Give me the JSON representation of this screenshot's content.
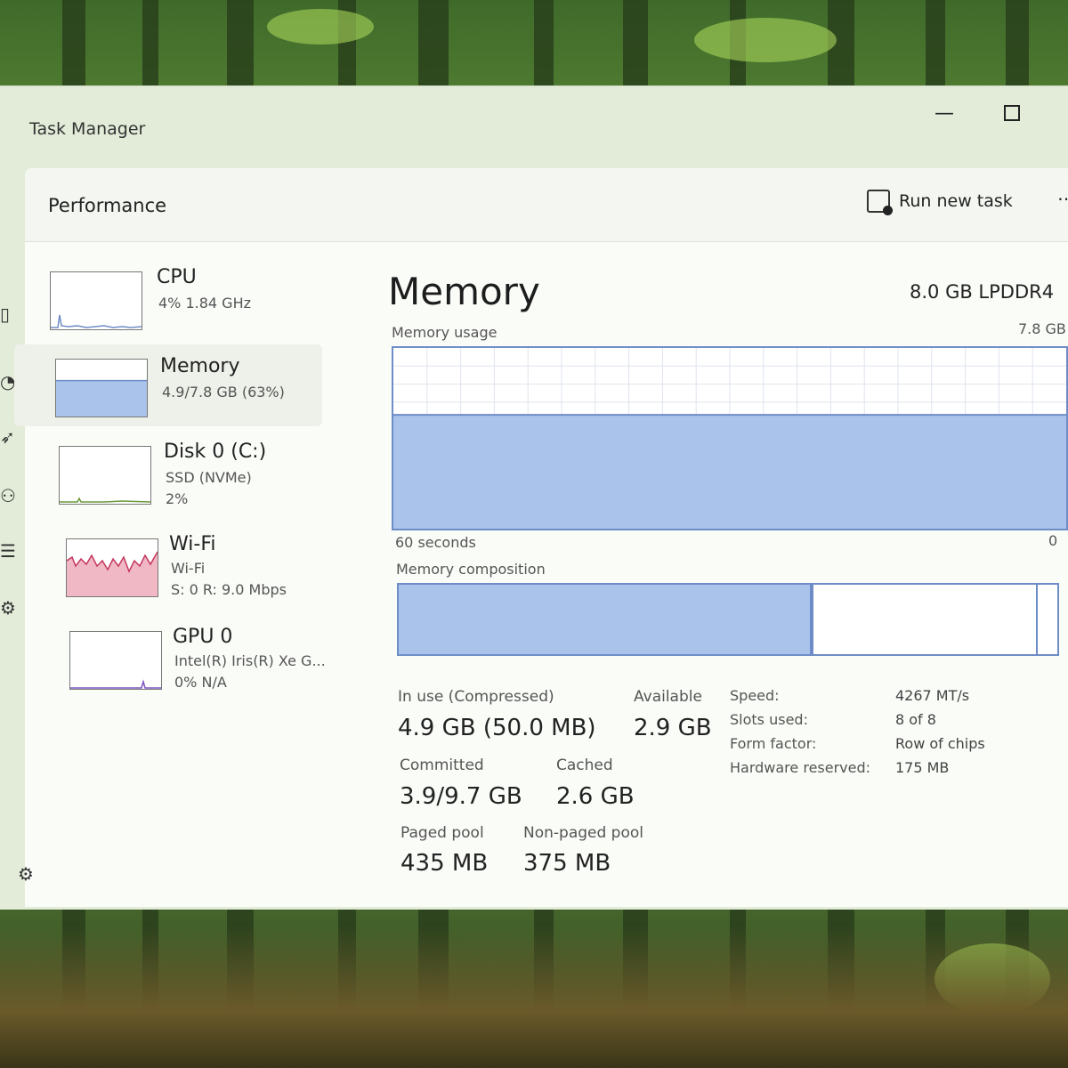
{
  "window": {
    "title": "Task Manager"
  },
  "header": {
    "title": "Performance",
    "run_new_task": "Run new task",
    "more": "⋯"
  },
  "sidebar": {
    "items": [
      {
        "name": "CPU",
        "line1": "4% 1.84 GHz",
        "line2": ""
      },
      {
        "name": "Memory",
        "line1": "4.9/7.8 GB (63%)",
        "line2": ""
      },
      {
        "name": "Disk 0 (C:)",
        "line1": "SSD (NVMe)",
        "line2": "2%"
      },
      {
        "name": "Wi-Fi",
        "line1": "Wi-Fi",
        "line2": "S: 0 R: 9.0 Mbps"
      },
      {
        "name": "GPU 0",
        "line1": "Intel(R) Iris(R) Xe G...",
        "line2": "0% N/A"
      }
    ]
  },
  "main": {
    "title": "Memory",
    "spec": "8.0 GB LPDDR4",
    "usage_label": "Memory usage",
    "usage_max": "7.8 GB",
    "time_span": "60 seconds",
    "usage_min": "0",
    "composition_label": "Memory composition",
    "usage_fraction": 0.63,
    "composition": {
      "in_use_fraction": 0.63,
      "available_fraction": 0.34
    }
  },
  "stats": {
    "in_use_label": "In use (Compressed)",
    "in_use_value": "4.9 GB (50.0 MB)",
    "available_label": "Available",
    "available_value": "2.9 GB",
    "committed_label": "Committed",
    "committed_value": "3.9/9.7 GB",
    "cached_label": "Cached",
    "cached_value": "2.6 GB",
    "paged_label": "Paged pool",
    "paged_value": "435 MB",
    "nonpaged_label": "Non-paged pool",
    "nonpaged_value": "375 MB"
  },
  "specs": [
    {
      "label": "Speed:",
      "value": "4267 MT/s"
    },
    {
      "label": "Slots used:",
      "value": "8 of 8"
    },
    {
      "label": "Form factor:",
      "value": "Row of chips"
    },
    {
      "label": "Hardware reserved:",
      "value": "175 MB"
    }
  ],
  "colors": {
    "memory_fill": "#a9c3ea",
    "memory_line": "#6e8dc6",
    "wifi_fill": "#f0b7c4",
    "wifi_line": "#c4375e",
    "panel_bg": "#fafcf8"
  }
}
